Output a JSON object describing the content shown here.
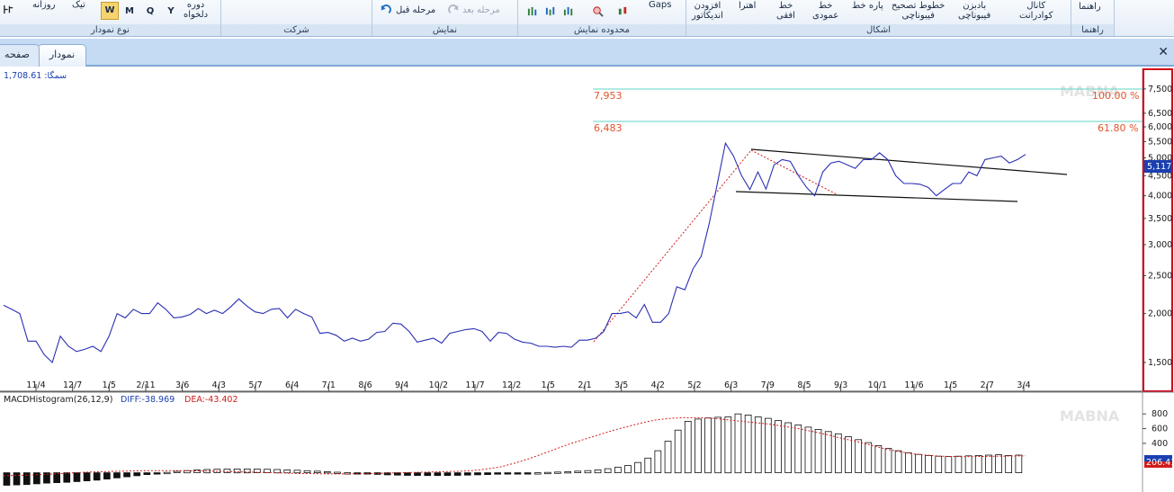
{
  "ribbon": {
    "chart_type": {
      "caption": "نوع نمودار",
      "period_label_1": "دوره",
      "period_label_2": "دلخواه",
      "daily": "روزانه",
      "tick": "تیک",
      "week": "W",
      "month": "M",
      "quarter": "Q",
      "year": "Y"
    },
    "company": {
      "caption": "شرکت"
    },
    "display": {
      "caption": "نمایش",
      "prev": "مرحله قبل",
      "next": "مرحله بعد"
    },
    "display_range": {
      "caption": "محدوده نمایش",
      "gaps": "Gaps"
    },
    "shapes": {
      "caption": "اشکال",
      "add_indicator_1": "افزودن",
      "add_indicator_2": "اندیکاتور",
      "fibonacci_arcs": "اهترا",
      "hline_1": "خط",
      "hline_2": "افقی",
      "vline_1": "خط",
      "vline_2": "عمودی",
      "segment_1": "پاره خط",
      "fib_retrace_1": "خطوط تصحیح",
      "fib_retrace_2": "فیبوناچی",
      "fan_1": "بادبزن",
      "fan_2": "فیبوناچی",
      "channel_1": "کانال",
      "channel_2": "کوادرانت"
    },
    "help": {
      "label": "راهنما",
      "caption": "راهنما"
    }
  },
  "tabs": {
    "chart": "نمودار",
    "page": "صفحه"
  },
  "chart": {
    "info_label": "سمگا: 1,708.61",
    "watermark": "MABNA",
    "current_price_label": "5,117",
    "fib_100_value": "7,953",
    "fib_100_pct": "100.00 %",
    "fib_618_value": "6,483",
    "fib_618_pct": "61.80 %",
    "macd_label": "MACDHistogram(26,12,9)",
    "macd_diff": "DIFF:-38.969",
    "macd_dea": "DEA:-43.402",
    "macd_current_label": "206.41",
    "colors": {
      "price_line": "#2b2fb3",
      "fib_line": "#5fd6c4",
      "fib_text": "#e0552b",
      "marker": "#1a3fb0",
      "panel_border": "#d0021b",
      "trend_dashed": "#d01c1c"
    }
  },
  "chart_data": [
    {
      "type": "line",
      "x": [
        "11/4",
        "12/7",
        "1/5",
        "2/11",
        "3/6",
        "4/3",
        "5/7",
        "6/4",
        "7/1",
        "8/6",
        "9/4",
        "10/2",
        "11/7",
        "12/2",
        "1/5",
        "2/1",
        "3/5",
        "4/2",
        "5/2",
        "6/3",
        "7/9",
        "8/5",
        "9/3",
        "10/1",
        "11/6",
        "1/5",
        "2/7",
        "3/4"
      ],
      "y_ticks": [
        "1,500",
        "2,000",
        "2,500",
        "3,000",
        "3,500",
        "4,000",
        "4,500",
        "5,000",
        "5,500",
        "6,000",
        "6,500",
        "7,500"
      ],
      "y_scale": "log",
      "ylim": [
        1300,
        8200
      ],
      "series": [
        {
          "values": [
            2100,
            2050,
            2000,
            1700,
            1700,
            1570,
            1500,
            1750,
            1650,
            1600,
            1620,
            1650,
            1600,
            1750,
            2000,
            1950,
            2050,
            2000,
            2000,
            2130,
            2050,
            1950,
            1960,
            1990,
            2060,
            2000,
            2040,
            2000,
            2080,
            2180,
            2090,
            2020,
            2000,
            2050,
            2060,
            1950,
            2050,
            2000,
            1960,
            1780,
            1790,
            1760,
            1700,
            1730,
            1700,
            1720,
            1790,
            1800,
            1890,
            1880,
            1800,
            1690,
            1710,
            1730,
            1680,
            1780,
            1800,
            1820,
            1830,
            1800,
            1700,
            1790,
            1780,
            1720,
            1690,
            1680,
            1650,
            1650,
            1640,
            1650,
            1640,
            1710,
            1710,
            1730,
            1800,
            2000,
            2000,
            2020,
            1950,
            2110,
            1900,
            1900,
            2000,
            2340,
            2300,
            2600,
            2800,
            3400,
            4300,
            5450,
            5050,
            4500,
            4150,
            4600,
            4160,
            4800,
            4950,
            4900,
            4500,
            4200,
            4000,
            4600,
            4850,
            4900,
            4800,
            4700,
            4950,
            4950,
            5150,
            4950,
            4500,
            4300,
            4300,
            4280,
            4200,
            4000,
            4150,
            4300,
            4300,
            4600,
            4500,
            4950,
            5000,
            5050,
            4850,
            4950,
            5100
          ]
        }
      ],
      "annotations": [
        "7,953 100.00 %",
        "6,483 61.80 %"
      ]
    },
    {
      "type": "bar",
      "title": "MACDHistogram(26,12,9)",
      "y_ticks": [
        "400",
        "600",
        "800"
      ],
      "ylim": [
        -200,
        900
      ],
      "series": [
        {
          "name": "MACDHistogram(26,12,9)",
          "values": [
            -170,
            -165,
            -160,
            -150,
            -140,
            -135,
            -130,
            -120,
            -110,
            -100,
            -85,
            -70,
            -55,
            -40,
            -25,
            -10,
            5,
            20,
            30,
            38,
            45,
            48,
            50,
            52,
            52,
            50,
            48,
            45,
            40,
            35,
            28,
            22,
            15,
            8,
            0,
            -8,
            -15,
            -22,
            -28,
            -32,
            -35,
            -37,
            -38,
            -38,
            -37,
            -35,
            -32,
            -28,
            -25,
            -20,
            -15,
            -10,
            -5,
            0,
            5,
            10,
            15,
            22,
            30,
            40,
            55,
            75,
            100,
            140,
            200,
            300,
            430,
            580,
            700,
            730,
            745,
            755,
            760,
            800,
            785,
            760,
            740,
            710,
            680,
            650,
            620,
            590,
            560,
            530,
            490,
            450,
            410,
            370,
            330,
            300,
            270,
            250,
            235,
            225,
            220,
            225,
            230,
            235,
            240,
            245,
            235,
            240
          ],
          "line_name": "DEA",
          "line_values": [
            -40,
            -35,
            -30,
            -20,
            -10,
            0,
            10,
            15,
            20,
            25,
            28,
            30,
            30,
            28,
            25,
            20,
            15,
            10,
            5,
            0,
            -5,
            -10,
            -12,
            -15,
            -15,
            -12,
            -10,
            -5,
            0,
            5,
            10,
            15,
            20,
            30,
            50,
            80,
            130,
            190,
            260,
            330,
            400,
            460,
            520,
            580,
            630,
            680,
            720,
            740,
            750,
            748,
            740,
            720,
            700,
            680,
            660,
            630,
            600,
            560,
            520,
            470,
            430,
            380,
            330,
            290,
            260,
            240,
            225,
            220,
            220,
            222,
            225,
            228,
            230
          ]
        }
      ]
    }
  ]
}
